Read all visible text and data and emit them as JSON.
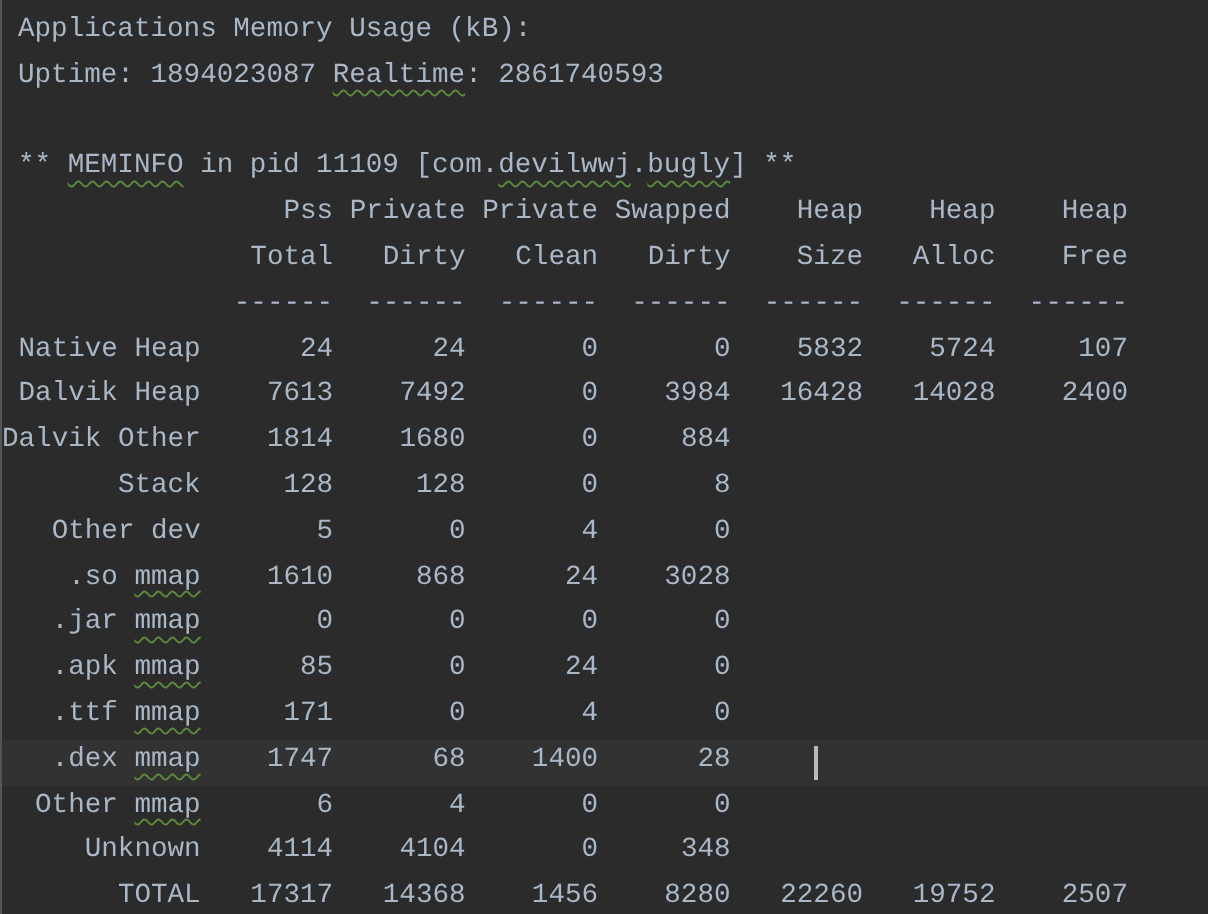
{
  "lines": [
    {
      "segments": [
        {
          "text": "Applications Memory Usage (kB):",
          "flagged": false
        }
      ]
    },
    {
      "segments": [
        {
          "text": "Uptime: 1894023087 ",
          "flagged": false
        },
        {
          "text": "Realtime",
          "flagged": true
        },
        {
          "text": ": 2861740593",
          "flagged": false
        }
      ]
    },
    {
      "segments": [
        {
          "text": "** ",
          "flagged": false
        },
        {
          "text": "MEMINFO",
          "flagged": true
        },
        {
          "text": " in pid 11109 [com.",
          "flagged": false
        },
        {
          "text": "devilwwj",
          "flagged": true
        },
        {
          "text": ".",
          "flagged": false
        },
        {
          "text": "bugly",
          "flagged": true
        },
        {
          "text": "] **",
          "flagged": false
        }
      ]
    }
  ],
  "header_rows": [
    {
      "cells": [
        "Pss",
        "Private",
        "Private",
        "Swapped",
        "Heap",
        "Heap",
        "Heap"
      ]
    },
    {
      "cells": [
        "Total",
        "Dirty",
        "Clean",
        "Dirty",
        "Size",
        "Alloc",
        "Free"
      ]
    },
    {
      "cells": [
        "------",
        "------",
        "------",
        "------",
        "------",
        "------",
        "------"
      ]
    }
  ],
  "rows": [
    {
      "label": [
        {
          "text": "Native Heap",
          "flagged": false
        }
      ],
      "cells": [
        "24",
        "24",
        "0",
        "0",
        "5832",
        "5724",
        "107"
      ],
      "current": false
    },
    {
      "label": [
        {
          "text": "Dalvik Heap",
          "flagged": false
        }
      ],
      "cells": [
        "7613",
        "7492",
        "0",
        "3984",
        "16428",
        "14028",
        "2400"
      ],
      "current": false
    },
    {
      "label": [
        {
          "text": "Dalvik Other",
          "flagged": false
        }
      ],
      "cells": [
        "1814",
        "1680",
        "0",
        "884"
      ],
      "current": false
    },
    {
      "label": [
        {
          "text": "Stack",
          "flagged": false
        }
      ],
      "cells": [
        "128",
        "128",
        "0",
        "8"
      ],
      "current": false
    },
    {
      "label": [
        {
          "text": "Other dev",
          "flagged": false
        }
      ],
      "cells": [
        "5",
        "0",
        "4",
        "0"
      ],
      "current": false
    },
    {
      "label": [
        {
          "text": ".so ",
          "flagged": false
        },
        {
          "text": "mmap",
          "flagged": true
        }
      ],
      "cells": [
        "1610",
        "868",
        "24",
        "3028"
      ],
      "current": false
    },
    {
      "label": [
        {
          "text": ".jar ",
          "flagged": false
        },
        {
          "text": "mmap",
          "flagged": true
        }
      ],
      "cells": [
        "0",
        "0",
        "0",
        "0"
      ],
      "current": false
    },
    {
      "label": [
        {
          "text": ".apk ",
          "flagged": false
        },
        {
          "text": "mmap",
          "flagged": true
        }
      ],
      "cells": [
        "85",
        "0",
        "24",
        "0"
      ],
      "current": false
    },
    {
      "label": [
        {
          "text": ".ttf ",
          "flagged": false
        },
        {
          "text": "mmap",
          "flagged": true
        }
      ],
      "cells": [
        "171",
        "0",
        "4",
        "0"
      ],
      "current": false
    },
    {
      "label": [
        {
          "text": ".dex ",
          "flagged": false
        },
        {
          "text": "mmap",
          "flagged": true
        }
      ],
      "cells": [
        "1747",
        "68",
        "1400",
        "28"
      ],
      "current": true
    },
    {
      "label": [
        {
          "text": "Other ",
          "flagged": false
        },
        {
          "text": "mmap",
          "flagged": true
        }
      ],
      "cells": [
        "6",
        "4",
        "0",
        "0"
      ],
      "current": false
    },
    {
      "label": [
        {
          "text": "Unknown",
          "flagged": false
        }
      ],
      "cells": [
        "4114",
        "4104",
        "0",
        "348"
      ],
      "current": false
    },
    {
      "label": [
        {
          "text": "TOTAL",
          "flagged": false
        }
      ],
      "cells": [
        "17317",
        "14368",
        "1456",
        "8280",
        "22260",
        "19752",
        "2507"
      ],
      "current": false
    }
  ]
}
